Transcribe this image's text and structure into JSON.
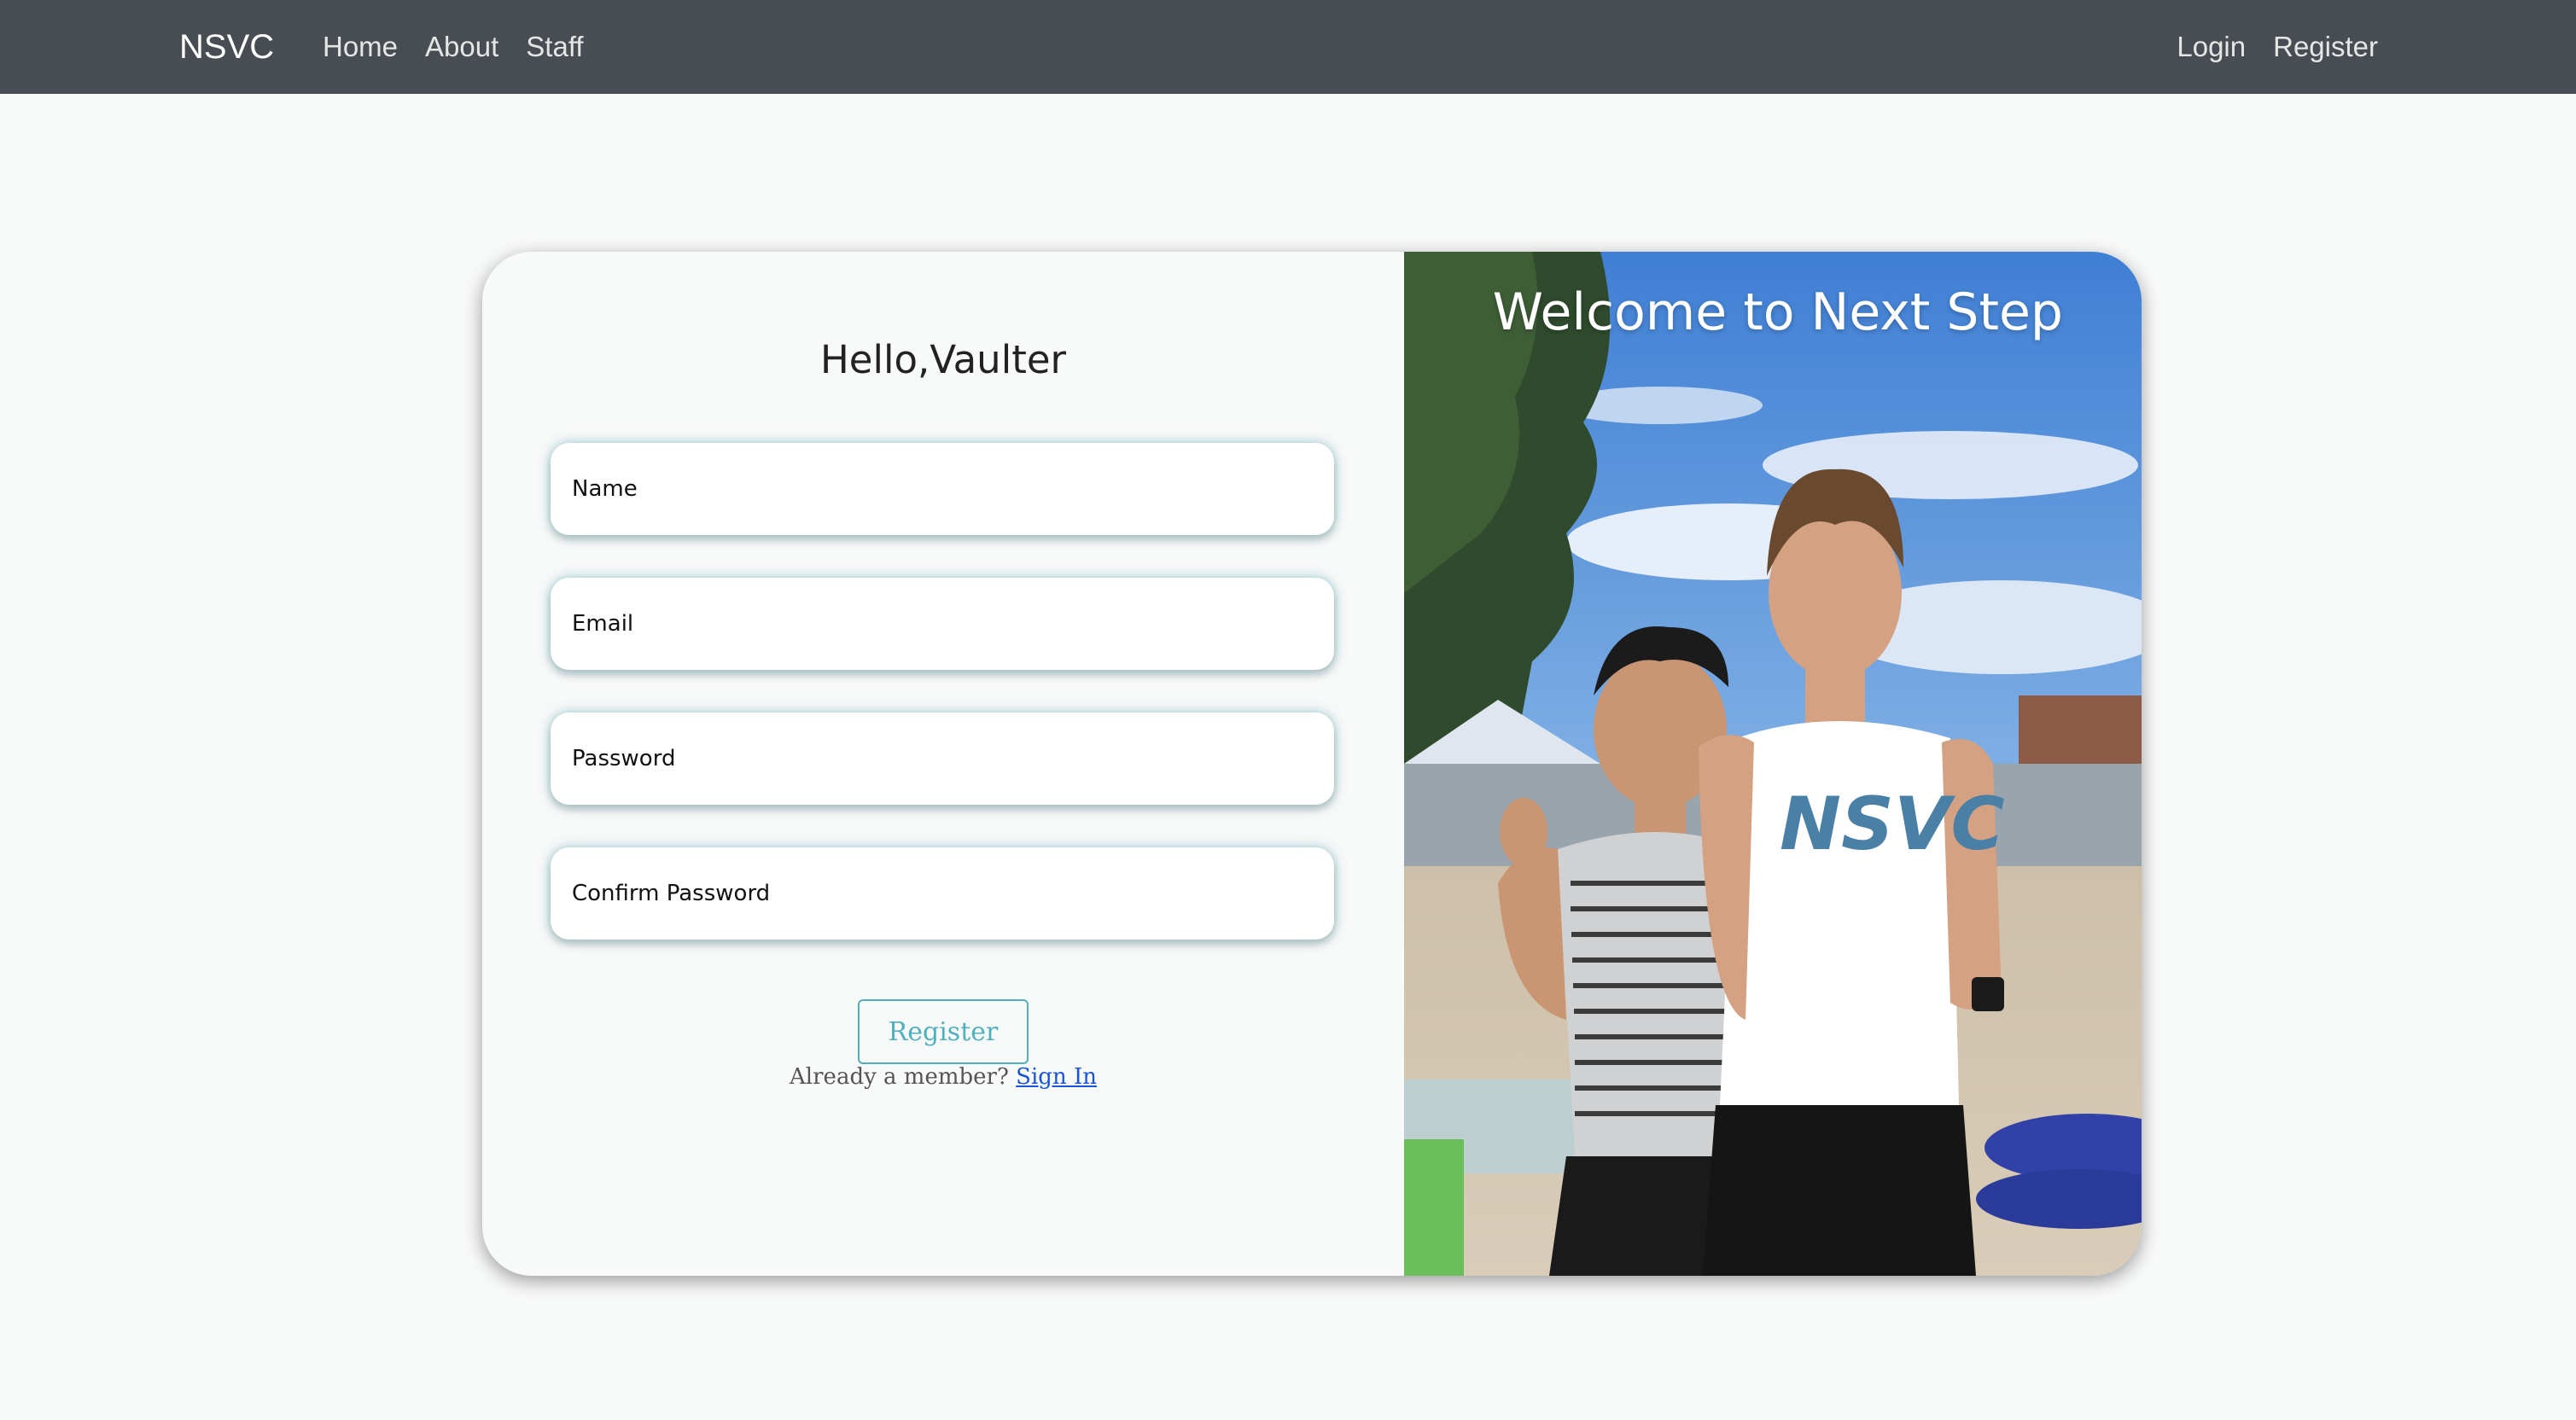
{
  "navbar": {
    "brand": "NSVC",
    "links_left": [
      "Home",
      "About",
      "Staff"
    ],
    "links_right": [
      "Login",
      "Register"
    ]
  },
  "form": {
    "title": "Hello,Vaulter",
    "fields": {
      "name": "Name",
      "email": "Email",
      "password": "Password",
      "confirm": "Confirm Password"
    },
    "submit_label": "Register",
    "member_text": "Already a member?",
    "signin_label": "Sign In"
  },
  "photo": {
    "welcome": "Welcome to Next Step",
    "shirt_text": "NSVC"
  },
  "colors": {
    "navbar": "#474d52",
    "accent": "#4eb1bd",
    "link": "#1a55d6",
    "page_bg": "#f8f9f9"
  }
}
